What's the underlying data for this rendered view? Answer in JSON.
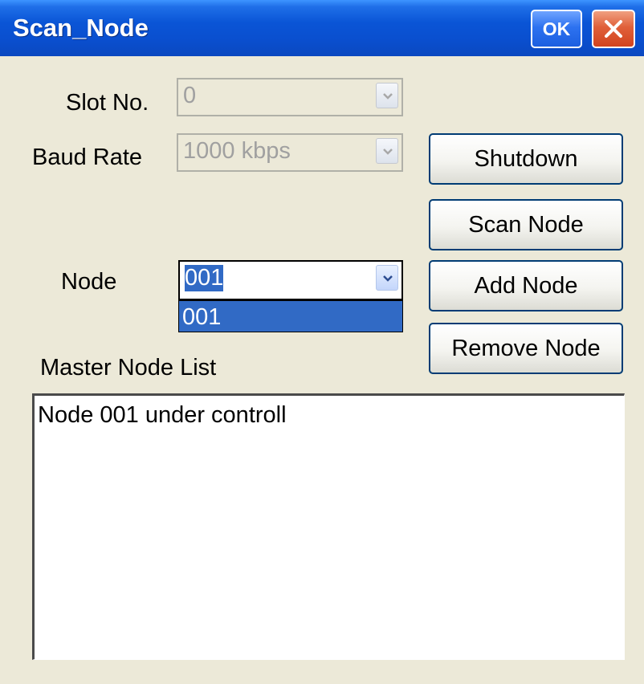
{
  "window": {
    "title": "Scan_Node",
    "ok_label": "OK",
    "accent_color": "#0a55d6",
    "selection_color": "#316ac5"
  },
  "slot": {
    "label": "Slot No.",
    "value": "0"
  },
  "baud": {
    "label": "Baud Rate",
    "value": "1000 kbps"
  },
  "node": {
    "label": "Node",
    "value": "001",
    "options": [
      "001"
    ]
  },
  "buttons": {
    "shutdown": "Shutdown",
    "scan_node": "Scan Node",
    "add_node": "Add Node",
    "remove_node": "Remove Node"
  },
  "master_list": {
    "label": "Master Node List",
    "items": [
      "Node 001 under controll"
    ]
  },
  "icons": {
    "close": "close-icon",
    "dropdown_arrow": "chevron-down-icon"
  }
}
